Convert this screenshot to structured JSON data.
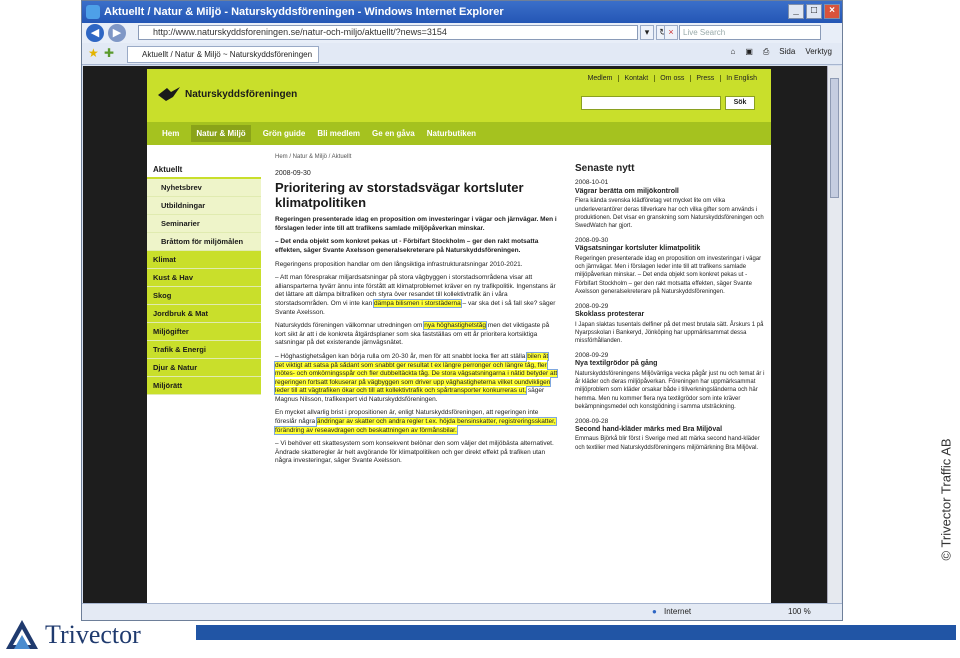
{
  "browser": {
    "title": "Aktuellt / Natur & Miljö - Naturskyddsföreningen - Windows Internet Explorer",
    "url": "http://www.naturskyddsforeningen.se/natur-och-miljo/aktuellt/?news=3154",
    "search_placeholder": "Live Search",
    "tab_label": "Aktuellt / Natur & Miljö ~ Naturskyddsföreningen",
    "tools": [
      "Sida",
      "Verktyg"
    ],
    "status": {
      "zone": "Internet",
      "zoom": "100 %"
    }
  },
  "site": {
    "logo": "Naturskyddsföreningen",
    "topnav": [
      "Medlem",
      "Kontakt",
      "Om oss",
      "Press",
      "In English"
    ],
    "search_button": "Sök",
    "mainnav": [
      "Hem",
      "Natur & Miljö",
      "Grön guide",
      "Bli medlem",
      "Ge en gåva",
      "Naturbutiken"
    ],
    "active_nav": "Natur & Miljö"
  },
  "sidebar": {
    "items": [
      {
        "label": "Aktuellt",
        "kind": "head"
      },
      {
        "label": "Nyhetsbrev",
        "kind": "sub"
      },
      {
        "label": "Utbildningar",
        "kind": "sub"
      },
      {
        "label": "Seminarier",
        "kind": "sub"
      },
      {
        "label": "Bråttom för miljömålen",
        "kind": "sub"
      },
      {
        "label": "Klimat",
        "kind": "green"
      },
      {
        "label": "Kust & Hav",
        "kind": "green"
      },
      {
        "label": "Skog",
        "kind": "green"
      },
      {
        "label": "Jordbruk & Mat",
        "kind": "green"
      },
      {
        "label": "Miljögifter",
        "kind": "green"
      },
      {
        "label": "Trafik & Energi",
        "kind": "green"
      },
      {
        "label": "Djur & Natur",
        "kind": "green"
      },
      {
        "label": "Miljörätt",
        "kind": "green"
      }
    ]
  },
  "article": {
    "breadcrumb": "Hem / Natur & Miljö / Aktuellt",
    "date": "2008-09-30",
    "title": "Prioritering av storstadsvägar kortsluter klimatpolitiken",
    "lede": "Regeringen presenterade idag en proposition om investeringar i vägar och järnvägar. Men i förslagen leder inte till att trafikens samlade miljöpåverkan minskar.",
    "quote1": "– Det enda objekt som konkret pekas ut - Förbifart Stockholm – ger den rakt motsatta effekten, säger Svante Axelsson generalsekreterare på Naturskyddsföreningen.",
    "p1": "Regeringens proposition handlar om den långsiktiga infrastrukturatsningar 2010-2021.",
    "p2a": "– Att man föresprakar miljardsatsningar på stora vägbyggen i storstadsområdena visar att alliansparterna tyvärr ännu inte förstått att klimatproblemet kräver en ny trafikpolitik. Ingenstans är det lättare att dämpa biltrafiken och styra över resandet till kollektivtrafik än i våra storstadsområden. Om vi inte kan",
    "p2hl": "dämpa bilismen i storstäderna",
    "p2b": "– var ska det i så fall ske? säger Svante Axelsson.",
    "p3a": "Naturskydds föreningen välkomnar utredningen om",
    "p3hl": "nya höghastighetståg",
    "p3b": "men det viktigaste på kort sikt är att i de konkreta åtgärdsplaner som ska fastställas om ett år prioritera kortsiktiga satsningar på det existerande järnvägsnätet.",
    "p4a": "– Höghastighetsågen kan börja rulla om 20-30 år, men för att snabbt locka fler att ställa",
    "p4hl": "bilen åt det viktigt att satsa på sådant som snabbt ger resultat t ex längre perronger och längre tåg, fler mötes- och omkörningsspår och fler dubbeltäckta tåg. De stora vägsatsningarna i nätid betyder att regeringen fortsatt fokuserar på vägbyggen som driver upp väghastigheterna vilket oundvikligen leder till att vägtrafiken ökar och till att kollektivtrafik och spårtransporter konkurreras ut,",
    "p4b": "säger Magnus Nilsson, trafikexpert vid Naturskyddsföreningen.",
    "p5a": "En mycket allvarlig brist i propositionen är, enligt Naturskyddsföreningen, att regeringen inte föreslår några",
    "p5hl": "ändringar av skatter och andra regler t.ex. höjda bensinskatter, registreringsskatter, förändring av reseavdragen och beskattningen av förmånsbilar.",
    "p6": "– Vi behöver ett skattesystem som konsekvent belönar den som väljer det miljöbästa alternativet. Ändrade skatteregler är helt avgörande för klimatpolitiken och ger direkt effekt på trafiken utan några investeringar, säger Svante Axelsson."
  },
  "news": {
    "heading": "Senaste nytt",
    "items": [
      {
        "date": "2008-10-01",
        "title": "Vägrar berätta om miljökontroll",
        "body": "Flera kända svenska klädföretag vet mycket lite om vilka underleverantörer deras tillverkare har och vilka gifter som används i produktionen. Det visar en granskning som Naturskyddsföreningen och SwedWatch har gjort."
      },
      {
        "date": "2008-09-30",
        "title": "Vägsatsningar kortsluter klimatpolitik",
        "body": "Regeringen presenterade idag en proposition om investeringar i vägar och järnvägar. Men i förslagen leder inte till att trafikens samlade miljöpåverkan minskar. – Det enda objekt som konkret pekas ut - Förbifart Stockholm – ger den rakt motsatta effekten, säger Svante Axelsson generalsekreterare på Naturskyddsföreningen."
      },
      {
        "date": "2008-09-29",
        "title": "Skoklass protesterar",
        "body": "I Japan slaktas tusentals delfiner på det mest brutala sätt. Årskurs 1 på Nyarpsskolan i Bankeryd, Jönköping har uppmärksammat dessa missförhållanden."
      },
      {
        "date": "2008-09-29",
        "title": "Nya textilgrödor på gång",
        "body": "Naturskyddsföreningens Miljövänliga vecka pågår just nu och temat är i år kläder och deras miljöpåverkan. Föreningen har uppmärksammat miljöproblem som kläder orsakar både i tillverkningsländerna och här hemma. Men nu kommer flera nya textilgrödor som inte kräver bekämpningsmedel och konstgödning i samma utsträckning."
      },
      {
        "date": "2008-09-28",
        "title": "Second hand-kläder märks med Bra Miljöval",
        "body": "Emmaus Björkå blir först i Sverige med att märka second hand-kläder och textilier med Naturskyddsföreningens miljömärkning Bra Miljöval."
      }
    ]
  },
  "slide": {
    "company": "Trivector",
    "copyright": "© Trivector Traffic AB",
    "colors": {
      "accent": "#2155a5",
      "green": "#c9df2b"
    }
  }
}
